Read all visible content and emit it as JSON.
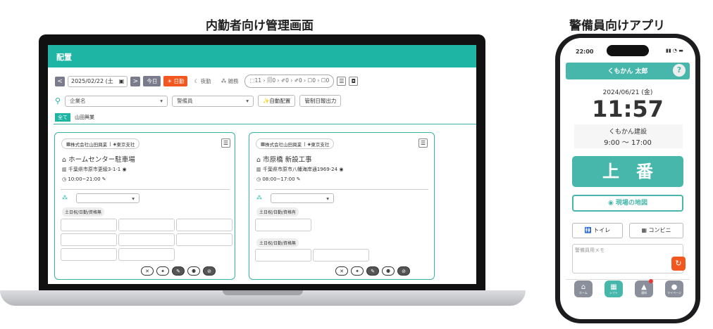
{
  "captions": {
    "desktop": "内勤者向け管理画面",
    "mobile": "警備員向けアプリ"
  },
  "admin": {
    "title": "配置",
    "toolbar": {
      "prev": "<",
      "date": "2025/02/22 (土",
      "next": ">",
      "today": "今日",
      "day": "日勤",
      "night": "夜勤",
      "misc": "雑務",
      "summary": "⬚11 › 🗐0 › ✐0 › ✐0 › ☐0 › ☐0"
    },
    "filters": {
      "company": "企業名",
      "guard": "警備員",
      "auto": "自動配置",
      "report": "管制日報出力"
    },
    "chips": {
      "all": "全て",
      "company": "山田興業"
    },
    "cards": [
      {
        "company": "株式会社山田興業",
        "branch": "東京支社",
        "site": "ホームセンター駐車場",
        "address": "千葉県市原市更級3-1-1",
        "time": "10:00~21:00",
        "tag": "土日祝/日勤/資格無"
      },
      {
        "company": "株式会社山田興業",
        "branch": "東京支社",
        "site": "市原橋 新設工事",
        "address": "千葉県市原市八幡海岸通1969-24",
        "time": "08:00~17:00",
        "tag1": "土日祝/日勤/資格有",
        "tag2": "土日祝/日勤/資格無"
      }
    ]
  },
  "mobile": {
    "clock": "22:00",
    "user": "くもかん 太郎",
    "help": "?",
    "date": "2024/06/21 (金)",
    "time": "11:57",
    "site": "くもかん建設",
    "hours": "9:00 〜 17:00",
    "shift": "上　番",
    "map": "現場の地図",
    "toilet": "トイレ",
    "store": "コンビニ",
    "memo_placeholder": "警備員用メモ",
    "nav": [
      "ホーム",
      "シフト",
      "通知",
      "マイページ"
    ]
  },
  "colors": {
    "teal": "#1fb5a5",
    "orange": "#f2571f",
    "gray": "#7b7b8e"
  }
}
